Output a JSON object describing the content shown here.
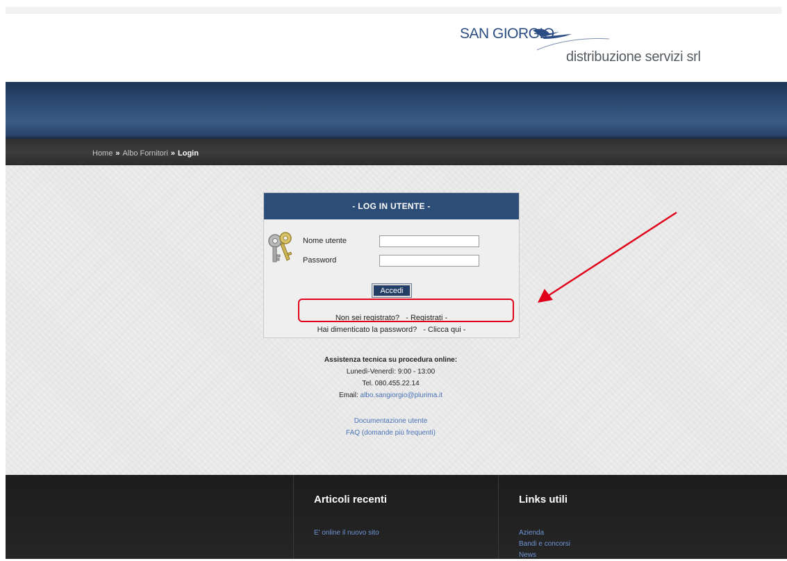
{
  "logo": {
    "brand": "SAN GIORGIO",
    "subtitle": "distribuzione servizi srl"
  },
  "breadcrumb": {
    "items": [
      "Home",
      "Albo Fornitori",
      "Login"
    ],
    "separator": "»"
  },
  "login": {
    "title": "- LOG IN UTENTE -",
    "username_label": "Nome utente",
    "password_label": "Password",
    "username_value": "",
    "password_value": "",
    "submit_label": "Accedi",
    "register_text": "Non sei registrato?",
    "register_link": "- Registrati -",
    "forgot_text": "Hai dimenticato la password?",
    "forgot_link": "- Clicca qui -"
  },
  "assistance": {
    "title": "Assistenza tecnica su procedura online:",
    "hours": "Lunedì-Venerdì: 9:00 - 13:00",
    "phone": "Tel. 080.455.22.14",
    "email_label": "Email:",
    "email": "albo.sangiorgio@plurima.it"
  },
  "docs": {
    "user_docs": "Documentazione utente",
    "faq": "FAQ (domande più frequenti)"
  },
  "footer": {
    "recent_title": "Articoli recenti",
    "recent_items": [
      "E' online il nuovo sito"
    ],
    "links_title": "Links utili",
    "links_items": [
      "Azienda",
      "Bandi e concorsi",
      "News"
    ]
  },
  "colors": {
    "header_blue": "#2d4d79",
    "link_blue": "#4a73b7",
    "annotation_red": "#e0001a"
  },
  "icons": [
    "keys-icon",
    "bird-logo-icon",
    "red-arrow-icon"
  ]
}
